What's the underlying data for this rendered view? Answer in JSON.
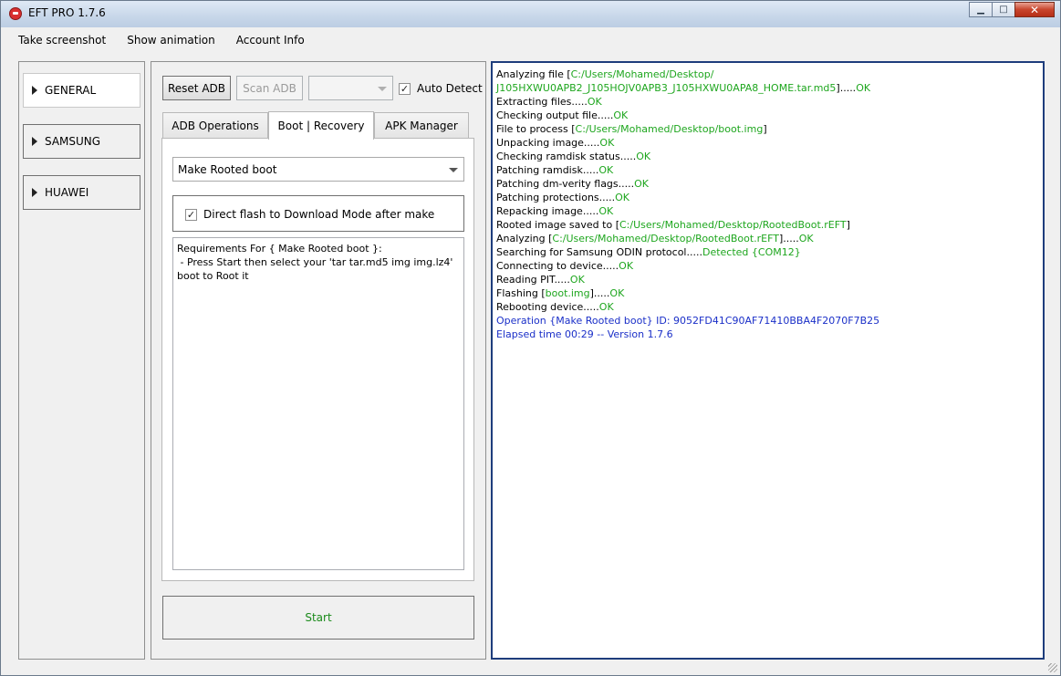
{
  "window": {
    "title": "EFT PRO 1.7.6"
  },
  "menu": [
    {
      "label": "Take screenshot"
    },
    {
      "label": "Show animation"
    },
    {
      "label": "Account Info"
    }
  ],
  "categories": [
    {
      "label": "GENERAL",
      "active": true
    },
    {
      "label": "SAMSUNG",
      "active": false
    },
    {
      "label": "HUAWEI",
      "active": false
    }
  ],
  "toolbar": {
    "reset_adb": "Reset ADB",
    "scan_adb": "Scan ADB",
    "device_select": "",
    "auto_detect": "Auto Detect",
    "auto_detect_checked": true
  },
  "tabs": [
    {
      "label": "ADB Operations",
      "active": false
    },
    {
      "label": "Boot | Recovery",
      "active": true
    },
    {
      "label": "APK Manager",
      "active": false
    }
  ],
  "boot": {
    "operation": "Make Rooted boot",
    "direct_flash_label": "Direct flash to Download Mode after make",
    "direct_flash_checked": true,
    "requirements": "Requirements For { Make Rooted boot }:\n - Press Start then select your 'tar tar.md5 img img.lz4'\nboot to Root it"
  },
  "start_label": "Start",
  "log": [
    [
      {
        "t": "Analyzing file ["
      },
      {
        "t": "C:/Users/Mohamed/Desktop/",
        "c": "g"
      }
    ],
    [
      {
        "t": "J105HXWU0APB2_J105HOJV0APB3_J105HXWU0APA8_HOME.tar.md5",
        "c": "g"
      },
      {
        "t": "]....."
      },
      {
        "t": "OK",
        "c": "g"
      }
    ],
    [
      {
        "t": "Extracting files....."
      },
      {
        "t": "OK",
        "c": "g"
      }
    ],
    [
      {
        "t": "Checking output file....."
      },
      {
        "t": "OK",
        "c": "g"
      }
    ],
    [
      {
        "t": "File to process ["
      },
      {
        "t": "C:/Users/Mohamed/Desktop/boot.img",
        "c": "g"
      },
      {
        "t": "]"
      }
    ],
    [
      {
        "t": "Unpacking image....."
      },
      {
        "t": "OK",
        "c": "g"
      }
    ],
    [
      {
        "t": "Checking ramdisk status....."
      },
      {
        "t": "OK",
        "c": "g"
      }
    ],
    [
      {
        "t": "Patching ramdisk....."
      },
      {
        "t": "OK",
        "c": "g"
      }
    ],
    [
      {
        "t": "Patching dm-verity flags....."
      },
      {
        "t": "OK",
        "c": "g"
      }
    ],
    [
      {
        "t": "Patching protections....."
      },
      {
        "t": "OK",
        "c": "g"
      }
    ],
    [
      {
        "t": "Repacking image....."
      },
      {
        "t": "OK",
        "c": "g"
      }
    ],
    [
      {
        "t": "Rooted image saved to ["
      },
      {
        "t": "C:/Users/Mohamed/Desktop/RootedBoot.rEFT",
        "c": "g"
      },
      {
        "t": "]"
      }
    ],
    [
      {
        "t": "Analyzing ["
      },
      {
        "t": "C:/Users/Mohamed/Desktop/RootedBoot.rEFT",
        "c": "g"
      },
      {
        "t": "]....."
      },
      {
        "t": "OK",
        "c": "g"
      }
    ],
    [
      {
        "t": "Searching for Samsung ODIN protocol....."
      },
      {
        "t": "Detected {COM12}",
        "c": "g"
      }
    ],
    [
      {
        "t": "Connecting to device....."
      },
      {
        "t": "OK",
        "c": "g"
      }
    ],
    [
      {
        "t": "Reading PIT....."
      },
      {
        "t": "OK",
        "c": "g"
      }
    ],
    [
      {
        "t": "Flashing ["
      },
      {
        "t": "boot.img",
        "c": "g"
      },
      {
        "t": "]....."
      },
      {
        "t": "OK",
        "c": "g"
      }
    ],
    [
      {
        "t": "Rebooting device....."
      },
      {
        "t": "OK",
        "c": "g"
      }
    ],
    [
      {
        "t": "Operation {Make Rooted boot} ID: 9052FD41C90AF71410BBA4F2070F7B25",
        "c": "b"
      }
    ],
    [
      {
        "t": "Elapsed time 00:29 -- Version 1.7.6",
        "c": "b"
      }
    ]
  ]
}
